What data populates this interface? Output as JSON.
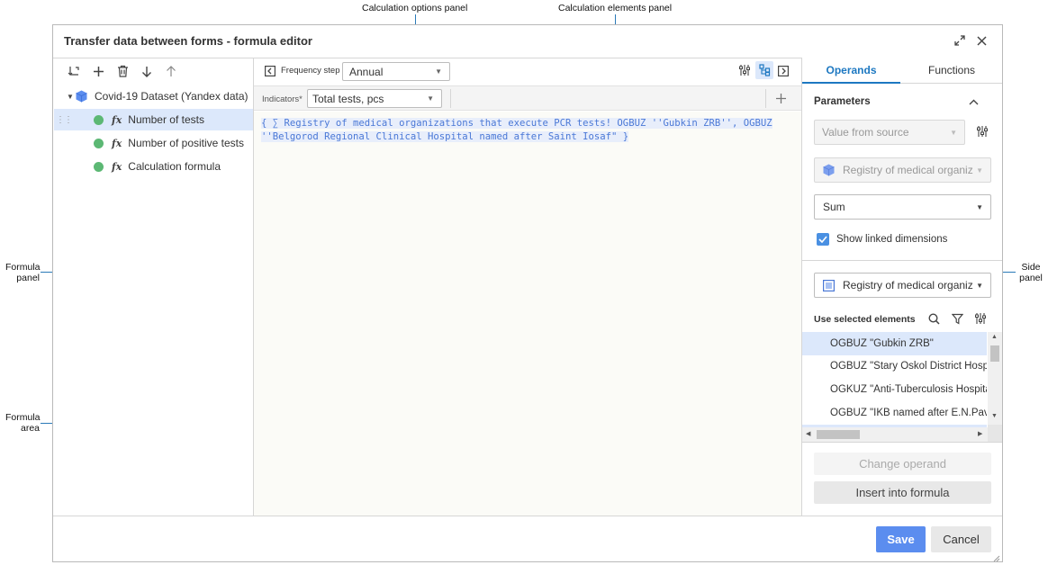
{
  "callouts": {
    "calc_options": "Calculation options panel",
    "calc_elements": "Calculation elements panel",
    "formula_panel_1": "Formula",
    "formula_panel_2": "panel",
    "formula_area_1": "Formula",
    "formula_area_2": "area",
    "side_panel_1": "Side",
    "side_panel_2": "panel"
  },
  "dialog": {
    "title": "Transfer data between forms - formula editor"
  },
  "tree": {
    "root": "Covid-19 Dataset (Yandex data)",
    "items": [
      {
        "label": "Number of tests",
        "selected": true
      },
      {
        "label": "Number of positive tests",
        "selected": false
      },
      {
        "label": "Calculation formula",
        "selected": false
      }
    ],
    "fx": "fx"
  },
  "options": {
    "frequency_label": "Frequency step",
    "frequency_value": "Annual",
    "indicators_label": "Indicators*",
    "indicators_value": "Total tests, pcs"
  },
  "formula": {
    "line1": "{ ∑ Registry of medical organizations that execute PCR tests! OGBUZ ''Gubkin ZRB'', OGBUZ",
    "line2": "''Belgorod Regional Clinical Hospital named after Saint Iosaf\" }"
  },
  "side": {
    "tabs": [
      "Operands",
      "Functions"
    ],
    "active_tab": "Operands",
    "parameters_label": "Parameters",
    "value_source": "Value from source",
    "registry1": "Registry of medical organiz",
    "aggregation": "Sum",
    "show_linked": "Show linked dimensions",
    "show_linked_checked": true,
    "registry2": "Registry of medical organiz",
    "use_selected": "Use selected elements",
    "elements": [
      "OGBUZ \"Gubkin ZRB\"",
      "OGBUZ \"Stary Oskol District Hospital",
      "OGKUZ \"Anti-Tuberculosis Hospital",
      "OGBUZ \"IKB named after E.N.Pavlo"
    ],
    "change_operand": "Change operand",
    "insert_formula": "Insert into formula"
  },
  "footer": {
    "save": "Save",
    "cancel": "Cancel"
  },
  "colors": {
    "accent": "#1d78c1",
    "selected_row": "#dce8fb",
    "formula_text": "#4a78d6",
    "save_button": "#5b8def",
    "status_green": "#5cb874"
  }
}
